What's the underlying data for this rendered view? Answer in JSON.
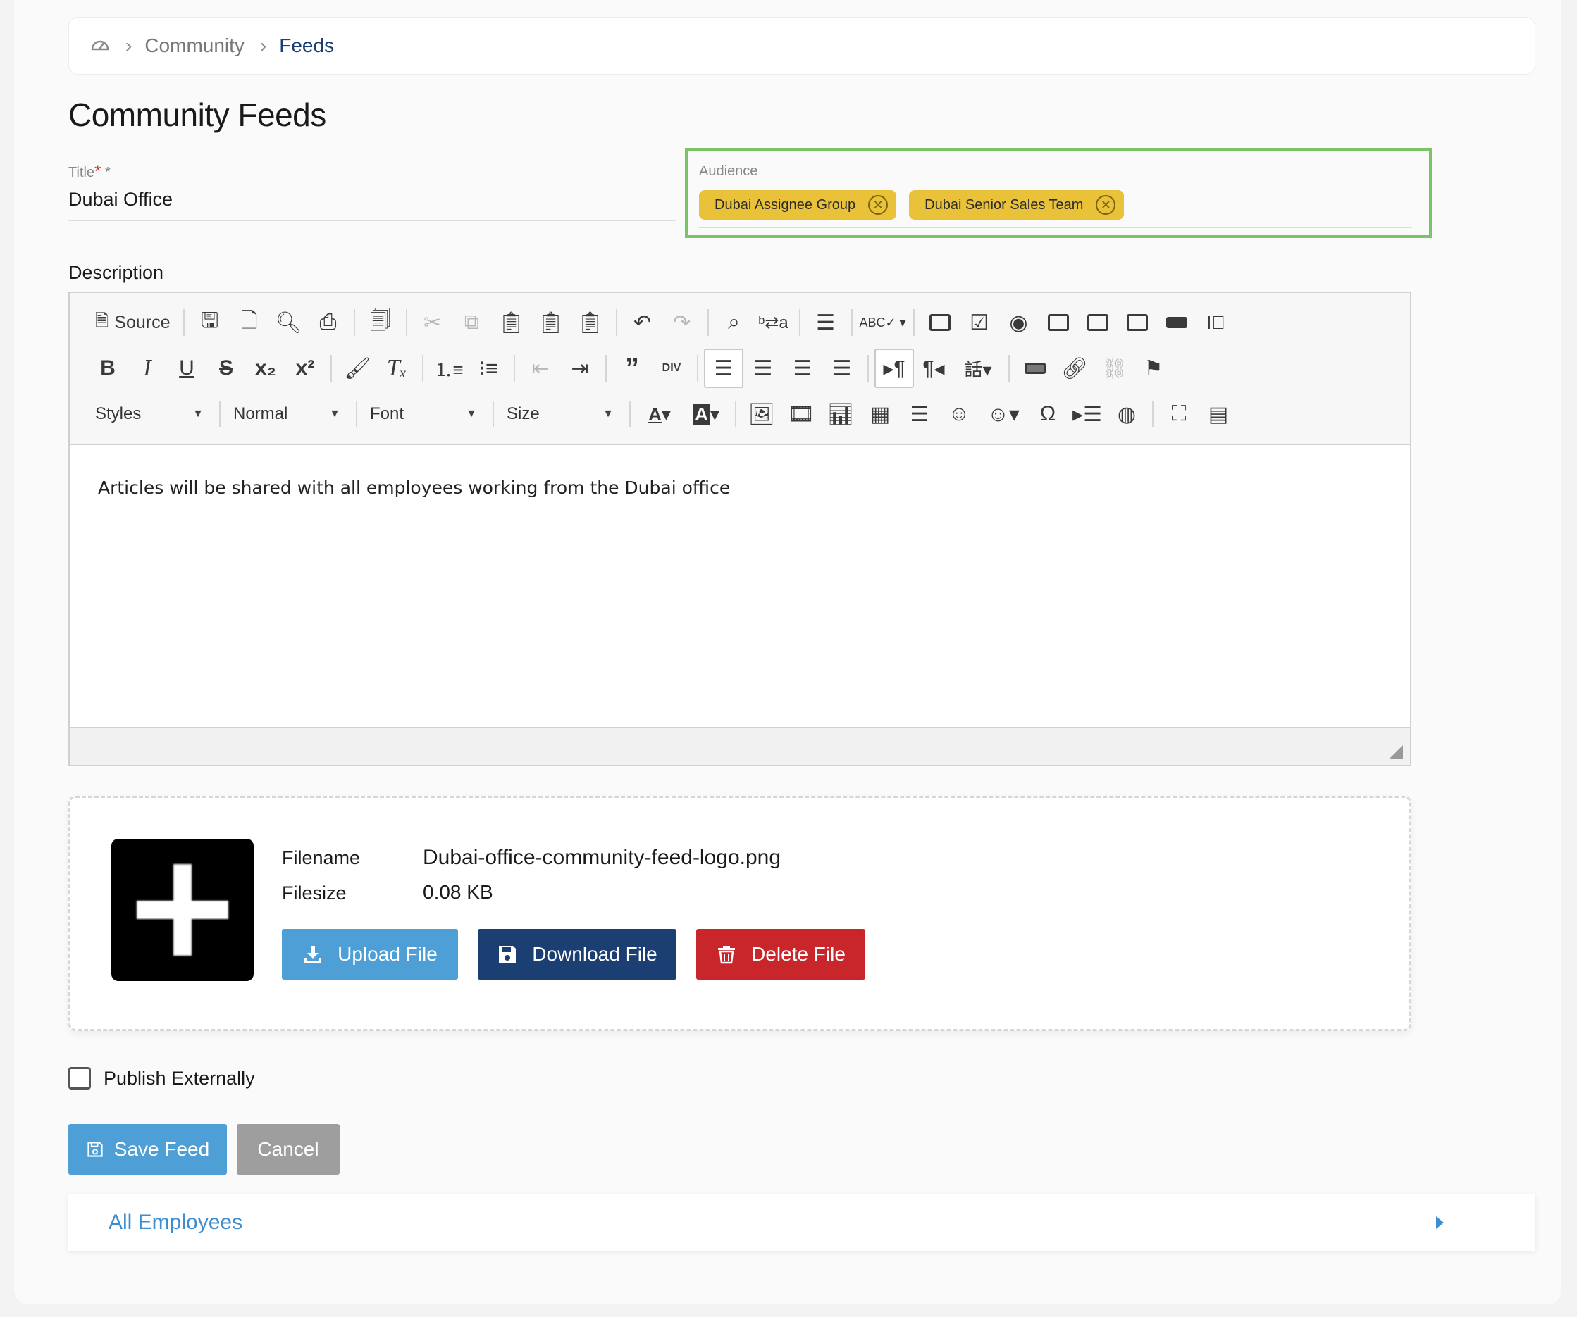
{
  "breadcrumb": {
    "home_icon": "dashboard-icon",
    "items": [
      "Community",
      "Feeds"
    ]
  },
  "page_title": "Community Feeds",
  "title_field": {
    "label": "Title",
    "required_mark": "*",
    "value": "Dubai Office"
  },
  "audience": {
    "label": "Audience",
    "chips": [
      "Dubai Assignee Group",
      "Dubai Senior Sales Team"
    ]
  },
  "description": {
    "label": "Description",
    "toolbar": {
      "source_label": "Source",
      "styles_label": "Styles",
      "format_label": "Normal",
      "font_label": "Font",
      "size_label": "Size"
    },
    "content": "Articles will be shared with all employees working from the Dubai office"
  },
  "file": {
    "filename_label": "Filename",
    "filename_value": "Dubai-office-community-feed-logo.png",
    "filesize_label": "Filesize",
    "filesize_value": "0.08 KB",
    "upload_label": "Upload File",
    "download_label": "Download File",
    "delete_label": "Delete File"
  },
  "publish_externally": {
    "label": "Publish Externally",
    "checked": false
  },
  "actions": {
    "save_label": "Save Feed",
    "cancel_label": "Cancel"
  },
  "accordion": {
    "label": "All Employees"
  },
  "colors": {
    "primary": "#4d9fd6",
    "navy": "#1b3e73",
    "danger": "#c9262b",
    "chip": "#e9c23a",
    "highlight": "#7bc465",
    "neutral": "#9e9e9e"
  }
}
